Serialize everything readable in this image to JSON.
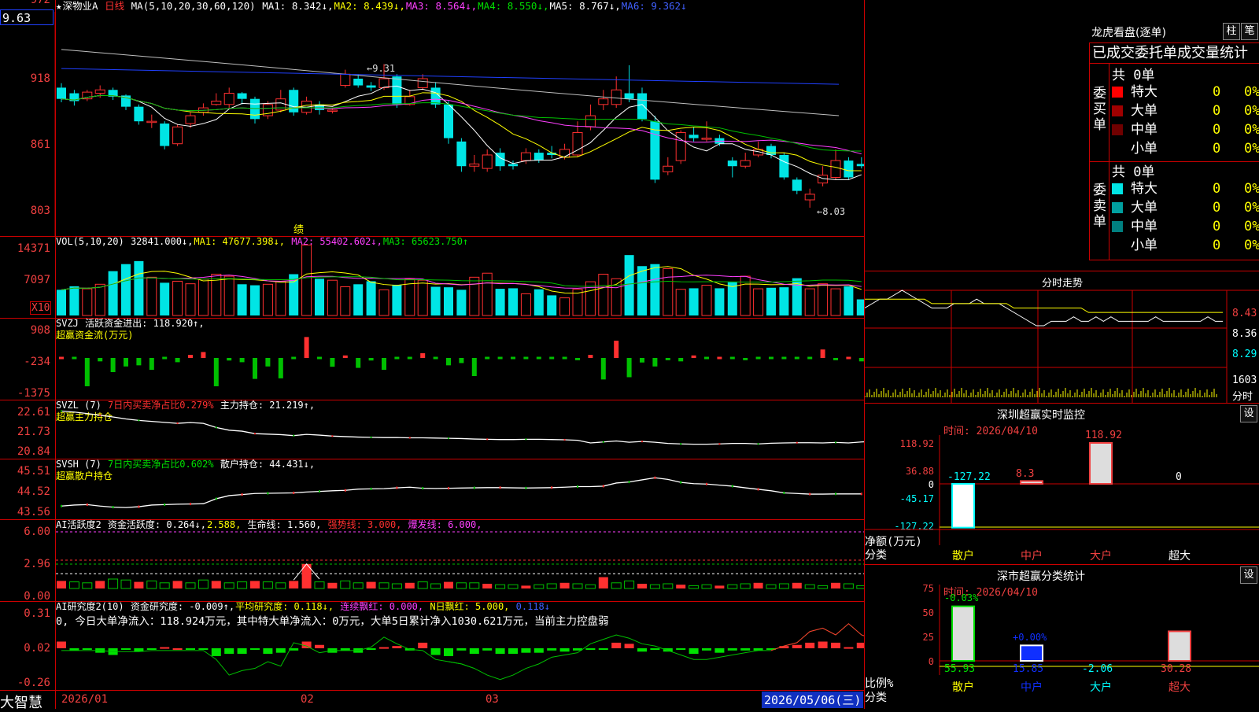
{
  "colors": {
    "up": "#ff3030",
    "down": "#00e5e5",
    "grid": "#c00000",
    "ma1": "#ffffff",
    "ma2": "#ffff00",
    "ma3": "#ff40ff",
    "ma4": "#00c000",
    "ma5": "#c0c0c0",
    "ma6": "#2040ff"
  },
  "price_box": "9.63",
  "top_axis_clip": "972",
  "kline": {
    "header": {
      "star": "★",
      "name": "深物业A",
      "period": "日线",
      "ma_label": "MA(5,10,20,30,60,120)",
      "ma1": "MA1: 8.342↓,",
      "ma2": "MA2: 8.439↓,",
      "ma3": "MA3: 8.564↓,",
      "ma4": "MA4: 8.550↓,",
      "ma5": "MA5: 8.767↓,",
      "ma6": "MA6: 9.362↓"
    },
    "axis": [
      "918",
      "861",
      "803"
    ],
    "high_note": "←9.31",
    "low_note": "←8.03",
    "event_mark": "绩",
    "candles": [
      [
        9.1,
        9.0,
        9.14,
        8.97
      ],
      [
        9.05,
        8.98,
        9.08,
        8.94
      ],
      [
        9.0,
        9.06,
        9.08,
        8.98
      ],
      [
        9.05,
        9.08,
        9.12,
        9.01
      ],
      [
        9.08,
        9.02,
        9.1,
        8.99
      ],
      [
        9.03,
        8.93,
        9.04,
        8.9
      ],
      [
        8.93,
        8.8,
        8.95,
        8.77
      ],
      [
        8.8,
        8.8,
        8.86,
        8.74
      ],
      [
        8.78,
        8.58,
        8.8,
        8.55
      ],
      [
        8.6,
        8.75,
        8.77,
        8.58
      ],
      [
        8.78,
        8.85,
        8.88,
        8.74
      ],
      [
        8.88,
        8.92,
        8.96,
        8.85
      ],
      [
        8.95,
        8.98,
        9.05,
        8.94
      ],
      [
        8.95,
        9.05,
        9.1,
        8.92
      ],
      [
        9.05,
        9.0,
        9.06,
        8.95
      ],
      [
        9.0,
        8.82,
        9.02,
        8.78
      ],
      [
        8.85,
        8.95,
        8.98,
        8.82
      ],
      [
        8.9,
        9.0,
        9.08,
        8.88
      ],
      [
        9.08,
        8.88,
        9.1,
        8.85
      ],
      [
        8.88,
        8.98,
        9.02,
        8.86
      ],
      [
        8.95,
        8.9,
        8.98,
        8.86
      ],
      [
        8.9,
        8.9,
        8.92,
        8.87
      ],
      [
        9.12,
        9.22,
        9.26,
        9.1
      ],
      [
        9.18,
        9.12,
        9.22,
        9.1
      ],
      [
        9.12,
        9.1,
        9.15,
        9.07
      ],
      [
        9.1,
        9.18,
        9.31,
        9.08
      ],
      [
        9.2,
        8.95,
        9.22,
        8.92
      ],
      [
        8.95,
        9.02,
        9.08,
        8.94
      ],
      [
        9.1,
        9.18,
        9.22,
        9.08
      ],
      [
        9.1,
        8.95,
        9.15,
        8.92
      ],
      [
        8.95,
        8.65,
        8.98,
        8.6
      ],
      [
        8.62,
        8.4,
        8.65,
        8.35
      ],
      [
        8.4,
        8.42,
        8.5,
        8.35
      ],
      [
        8.38,
        8.5,
        8.55,
        8.35
      ],
      [
        8.52,
        8.4,
        8.56,
        8.36
      ],
      [
        8.42,
        8.4,
        8.45,
        8.37
      ],
      [
        8.45,
        8.52,
        8.56,
        8.42
      ],
      [
        8.52,
        8.45,
        8.55,
        8.43
      ],
      [
        8.52,
        8.5,
        8.58,
        8.47
      ],
      [
        8.48,
        8.55,
        8.6,
        8.46
      ],
      [
        8.5,
        8.7,
        8.8,
        8.48
      ],
      [
        8.75,
        8.85,
        8.95,
        8.72
      ],
      [
        8.95,
        9.0,
        9.08,
        8.9
      ],
      [
        8.95,
        9.08,
        9.2,
        8.92
      ],
      [
        9.05,
        9.0,
        9.3,
        8.97
      ],
      [
        9.05,
        8.82,
        9.1,
        8.8
      ],
      [
        8.8,
        8.28,
        8.85,
        8.25
      ],
      [
        8.35,
        8.4,
        8.48,
        8.32
      ],
      [
        8.45,
        8.7,
        8.72,
        8.42
      ],
      [
        8.68,
        8.65,
        8.75,
        8.62
      ],
      [
        8.65,
        8.65,
        8.8,
        8.62
      ],
      [
        8.65,
        8.6,
        8.68,
        8.58
      ],
      [
        8.45,
        8.4,
        8.48,
        8.3
      ],
      [
        8.4,
        8.45,
        8.52,
        8.38
      ],
      [
        8.5,
        8.55,
        8.62,
        8.48
      ],
      [
        8.58,
        8.5,
        8.6,
        8.47
      ],
      [
        8.5,
        8.3,
        8.52,
        8.28
      ],
      [
        8.28,
        8.18,
        8.3,
        8.15
      ],
      [
        8.1,
        8.15,
        8.2,
        8.03
      ],
      [
        8.25,
        8.32,
        8.4,
        8.22
      ],
      [
        8.3,
        8.45,
        8.55,
        8.28
      ],
      [
        8.45,
        8.3,
        8.48,
        8.28
      ],
      [
        8.42,
        8.4,
        8.48,
        8.38
      ]
    ]
  },
  "vol": {
    "header": {
      "label": "VOL(5,10,20)",
      "v": "32841.000↓,",
      "ma1": "MA1: 47677.398↓,",
      "ma2": "MA2: 55402.602↓,",
      "ma3": "MA3: 65623.750↑"
    },
    "axis": [
      "14371",
      "7097"
    ],
    "unit": "X10",
    "values": [
      5100,
      5800,
      5300,
      6200,
      8800,
      10200,
      10800,
      7600,
      6500,
      6800,
      6300,
      7200,
      8200,
      7800,
      6200,
      6000,
      6200,
      6800,
      8200,
      14000,
      7300,
      7000,
      5700,
      6200,
      6800,
      5100,
      6100,
      7200,
      7000,
      5700,
      5600,
      5100,
      7600,
      8400,
      5300,
      5400,
      4300,
      5200,
      4000,
      3500,
      5200,
      6700,
      8200,
      7300,
      12000,
      9800,
      10200,
      9300,
      5200,
      5400,
      6000,
      5400,
      6600,
      7800,
      5300,
      5500,
      5600,
      7400,
      5300,
      6300,
      5300,
      5800,
      3200
    ]
  },
  "svzj": {
    "header": {
      "label": "SVZJ",
      "t1": "活跃资金进出: 118.920↑,",
      "t2": "超赢资金流(万元)"
    },
    "axis": [
      "908",
      "-234",
      "-1375"
    ],
    "values": [
      20,
      -30,
      -1000,
      -120,
      -500,
      -300,
      -260,
      -420,
      -60,
      -150,
      110,
      210,
      -1000,
      -90,
      -150,
      -740,
      -300,
      -720,
      -20,
      740,
      -30,
      -310,
      90,
      -350,
      -90,
      -420,
      -50,
      -60,
      170,
      -40,
      -260,
      -180,
      -640,
      -70,
      -60,
      -40,
      -50,
      -40,
      -40,
      -60,
      -80,
      110,
      -760,
      610,
      -680,
      -160,
      -300,
      -80,
      -120,
      90,
      -40,
      40,
      -60,
      -80,
      -40,
      -50,
      -40,
      -70,
      -30,
      300,
      -80,
      60,
      -120,
      210,
      -60
    ]
  },
  "svzl": {
    "header": {
      "label": "SVZL (7)",
      "t1": "7日内买卖净占比0.279%",
      "t2": "主力持仓: 21.219↑,",
      "t3": "超赢主力持仓"
    },
    "axis": [
      "22.61",
      "21.73",
      "20.84"
    ],
    "values": [
      22.62,
      22.58,
      22.52,
      22.45,
      22.38,
      22.3,
      22.24,
      22.2,
      22.16,
      22.12,
      22.15,
      22.12,
      21.95,
      21.84,
      21.8,
      21.7,
      21.68,
      21.66,
      21.62,
      21.67,
      21.64,
      21.6,
      21.58,
      21.56,
      21.55,
      21.54,
      21.54,
      21.53,
      21.53,
      21.52,
      21.51,
      21.5,
      21.48,
      21.47,
      21.46,
      21.46,
      21.47,
      21.47,
      21.46,
      21.45,
      21.43,
      21.32,
      21.36,
      21.4,
      21.35,
      21.38,
      21.35,
      21.3,
      21.28,
      21.27,
      21.27,
      21.28,
      21.3,
      21.3,
      21.28,
      21.31,
      21.32,
      21.33,
      21.33,
      21.32,
      21.34,
      21.32,
      21.36,
      21.4,
      21.38,
      21.38
    ]
  },
  "svsh": {
    "header": {
      "label": "SVSH (7)",
      "t1": "7日内买卖净占比0.602%",
      "t2": "散户持仓: 44.431↓,",
      "t3": "超赢散户持仓"
    },
    "axis": [
      "45.51",
      "44.52",
      "43.56"
    ],
    "values": [
      43.85,
      43.9,
      43.92,
      43.85,
      43.8,
      43.78,
      43.82,
      43.9,
      43.92,
      43.94,
      43.95,
      43.96,
      44.2,
      44.35,
      44.4,
      44.45,
      44.46,
      44.47,
      44.48,
      44.52,
      44.55,
      44.58,
      44.6,
      44.66,
      44.67,
      44.68,
      44.72,
      44.75,
      44.7,
      44.69,
      44.7,
      44.71,
      44.72,
      44.73,
      44.73,
      44.72,
      44.71,
      44.72,
      44.73,
      44.75,
      44.78,
      44.78,
      44.8,
      44.95,
      45.0,
      45.1,
      45.2,
      45.12,
      44.98,
      44.92,
      44.9,
      44.85,
      44.8,
      44.72,
      44.65,
      44.58,
      44.48,
      44.45,
      44.42,
      44.42,
      44.43,
      44.43,
      44.43
    ]
  },
  "ai1": {
    "header": {
      "label": "AI活跃度2",
      "t1": "资金活跃度: 0.264↓,",
      "t2": "2.588,",
      "t3": "生命线: 1.560,",
      "t4": "强势线: 3.000,",
      "t5": "爆发线: 6.000,"
    },
    "axis": [
      "6.00",
      "2.96",
      "0.00"
    ],
    "values": [
      0.8,
      0.7,
      0.6,
      0.8,
      1.0,
      0.9,
      0.7,
      0.8,
      0.6,
      0.8,
      0.6,
      0.9,
      0.8,
      0.6,
      0.7,
      0.8,
      0.7,
      0.6,
      0.8,
      2.6,
      0.7,
      0.6,
      0.8,
      0.6,
      0.7,
      0.6,
      0.5,
      0.6,
      0.7,
      0.5,
      0.7,
      0.6,
      0.6,
      0.5,
      0.4,
      0.4,
      0.3,
      0.4,
      0.5,
      0.6,
      0.5,
      0.4,
      1.2,
      0.6,
      0.8,
      0.5,
      0.4,
      0.5,
      0.4,
      0.3,
      0.4,
      0.3,
      0.4,
      0.5,
      0.6,
      0.4,
      0.5,
      0.6,
      0.4,
      0.3,
      0.6,
      0.5,
      0.3,
      0.3
    ]
  },
  "ai2": {
    "header": {
      "label": "AI研究度2(10)",
      "t1": "资金研究度: -0.009↑,",
      "t2": "平均研究度: 0.118↓,",
      "t3": "连续飘红: 0.000,",
      "t4": "N日飘红: 5.000,",
      "t5": "0.118↓"
    },
    "note": "0, 今日大单净流入：118.924万元，其中特大单净流入：0万元，大单5日累计净入1030.621万元，当前主力控盘弱",
    "axis": [
      "0.31",
      "0.02",
      "-0.26"
    ],
    "values": [
      0.06,
      -0.02,
      -0.01,
      -0.04,
      -0.06,
      -0.01,
      -0.03,
      -0.01,
      0.01,
      0.0,
      -0.01,
      -0.01,
      -0.07,
      -0.05,
      -0.05,
      -0.01,
      -0.05,
      -0.04,
      -0.02,
      0.06,
      0.03,
      -0.04,
      -0.02,
      -0.04,
      -0.01,
      0.01,
      0.02,
      -0.02,
      0.05,
      -0.06,
      -0.07,
      -0.02,
      -0.05,
      -0.02,
      -0.05,
      -0.05,
      -0.04,
      -0.04,
      -0.02,
      -0.03,
      -0.02,
      -0.01,
      -0.01,
      0.05,
      0.04,
      -0.03,
      -0.01,
      -0.03,
      -0.01,
      -0.05,
      -0.02,
      -0.04,
      -0.02,
      -0.02,
      -0.02,
      -0.01,
      0.02,
      0.03,
      0.05,
      0.06,
      0.05,
      0.01,
      0.05,
      -0.01
    ],
    "line": [
      -0.02,
      -0.02,
      -0.02,
      -0.02,
      -0.03,
      -0.03,
      -0.03,
      -0.02,
      -0.02,
      -0.02,
      -0.02,
      -0.02,
      -0.1,
      -0.24,
      -0.2,
      -0.18,
      -0.12,
      -0.16,
      0.05,
      0.02,
      -0.04,
      -0.02,
      -0.02,
      -0.02,
      0.01,
      0.1,
      0.04,
      -0.01,
      -0.02,
      -0.1,
      -0.12,
      -0.14,
      -0.18,
      -0.24,
      -0.28,
      -0.24,
      -0.18,
      -0.14,
      -0.08,
      -0.06,
      -0.04,
      0.04,
      0.08,
      0.12,
      0.09,
      0.04,
      0.02,
      -0.02,
      -0.06,
      -0.1,
      -0.1,
      -0.08,
      -0.06,
      -0.04,
      -0.02,
      -0.02,
      0.02,
      0.05,
      0.15,
      0.18,
      0.12,
      0.22,
      0.12,
      0.08
    ]
  },
  "dates": {
    "d1": "2026/01",
    "d2": "02",
    "d3": "03",
    "current": "2026/05/06(三)"
  },
  "brand": "大智慧",
  "lhb": {
    "title": "龙虎看盘(逐单)",
    "btn1": "柱",
    "btn2": "笔",
    "header": "已成交委托单成交量统计",
    "buy_title": "委买单",
    "sell_title": "委卖单",
    "buy_total": "共 0单",
    "sell_total": "共 0单",
    "buy_rows": [
      {
        "label": "特大",
        "v": "0",
        "p": "0%",
        "c": "#ff0000"
      },
      {
        "label": "大单",
        "v": "0",
        "p": "0%",
        "c": "#a00000"
      },
      {
        "label": "中单",
        "v": "0",
        "p": "0%",
        "c": "#700000"
      },
      {
        "label": "小单",
        "v": "0",
        "p": "0%",
        "c": "#000"
      }
    ],
    "sell_rows": [
      {
        "label": "特大",
        "v": "0",
        "p": "0%",
        "c": "#00e5e5"
      },
      {
        "label": "大单",
        "v": "0",
        "p": "0%",
        "c": "#00a0a0"
      },
      {
        "label": "中单",
        "v": "0",
        "p": "0%",
        "c": "#008080"
      },
      {
        "label": "小单",
        "v": "0",
        "p": "0%",
        "c": "#000"
      }
    ]
  },
  "intraday": {
    "title": "分时走势",
    "axis": [
      "8.43",
      "8.36",
      "8.29"
    ],
    "vol_label": "1603",
    "vol_unit": "分时",
    "price": [
      8.41,
      8.42,
      8.43,
      8.43,
      8.44,
      8.45,
      8.44,
      8.43,
      8.42,
      8.41,
      8.41,
      8.41,
      8.42,
      8.42,
      8.42,
      8.43,
      8.42,
      8.42,
      8.42,
      8.41,
      8.4,
      8.39,
      8.38,
      8.37,
      8.37,
      8.38,
      8.38,
      8.38,
      8.39,
      8.38,
      8.38,
      8.39,
      8.38,
      8.39,
      8.38,
      8.38,
      8.38,
      8.38,
      8.38,
      8.39,
      8.38,
      8.38,
      8.38,
      8.38,
      8.38,
      8.38,
      8.39,
      8.38,
      8.38
    ],
    "avg": [
      8.43,
      8.43,
      8.43,
      8.43,
      8.43,
      8.43,
      8.43,
      8.43,
      8.43,
      8.42,
      8.42,
      8.42,
      8.42,
      8.42,
      8.42,
      8.42,
      8.42,
      8.42,
      8.42,
      8.42,
      8.41,
      8.41,
      8.41,
      8.41,
      8.41,
      8.41,
      8.41,
      8.41,
      8.41,
      8.41,
      8.4,
      8.4,
      8.4,
      8.4,
      8.4,
      8.4,
      8.4,
      8.4,
      8.4,
      8.4,
      8.4,
      8.4,
      8.4,
      8.4,
      8.4,
      8.4,
      8.4,
      8.4,
      8.4
    ]
  },
  "sz_monitor": {
    "title": "深圳超赢实时监控",
    "btn": "设",
    "time": "时间: 2026/04/10",
    "axis": [
      "118.92",
      "36.88",
      "0",
      "-45.17",
      "-127.22"
    ],
    "ylabel": "净额(万元)",
    "xlabel": "分类",
    "cats": [
      "散户",
      "中户",
      "大户",
      "超大"
    ],
    "values": [
      -127.22,
      8.3,
      118.92,
      0
    ],
    "labels": [
      "-127.22",
      "8.3",
      "118.92",
      "0"
    ]
  },
  "sz_stats": {
    "title": "深市超赢分类统计",
    "btn": "设",
    "time": "时间: 2026/04/10",
    "axis": [
      "75",
      "50",
      "25",
      "0"
    ],
    "ylabel": "比例%",
    "xlabel": "分类",
    "cats": [
      "散户",
      "中户",
      "大户",
      "超大"
    ],
    "values": [
      55.93,
      15.85,
      0,
      30.28
    ],
    "top_labels": [
      "-0.03%",
      "+0.00%",
      "",
      ""
    ],
    "bottom_labels": [
      "55.93",
      "15.85",
      "-2.06",
      "30.28"
    ]
  }
}
